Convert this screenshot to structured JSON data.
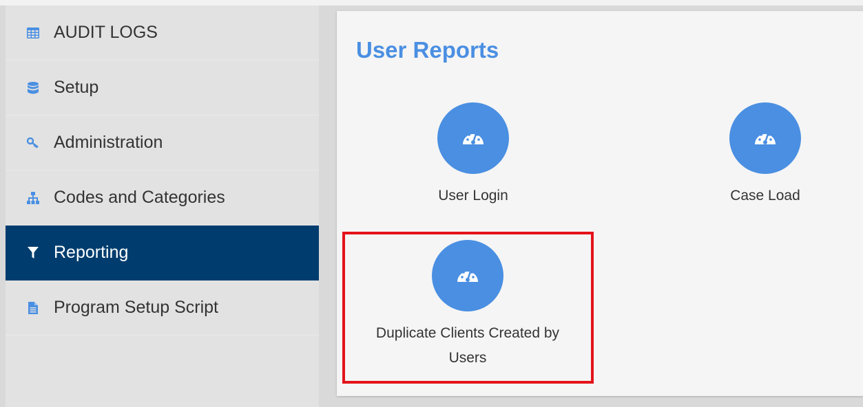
{
  "sidebar": {
    "items": [
      {
        "label": "AUDIT LOGS",
        "icon": "table-icon"
      },
      {
        "label": "Setup",
        "icon": "database-icon"
      },
      {
        "label": "Administration",
        "icon": "key-icon"
      },
      {
        "label": "Codes and Categories",
        "icon": "sitemap-icon"
      },
      {
        "label": "Reporting",
        "icon": "filter-icon",
        "active": true
      },
      {
        "label": "Program Setup Script",
        "icon": "file-icon"
      }
    ]
  },
  "main": {
    "title": "User Reports",
    "reports": [
      {
        "label": "User Login",
        "icon": "dashboard-icon"
      },
      {
        "label": "Case Load",
        "icon": "dashboard-icon"
      },
      {
        "label": "Duplicate Clients Created by Users",
        "icon": "dashboard-icon",
        "highlighted": true
      }
    ]
  },
  "colors": {
    "accent": "#4a8fe2",
    "active_nav": "#003d6e",
    "highlight": "#e4131b"
  }
}
